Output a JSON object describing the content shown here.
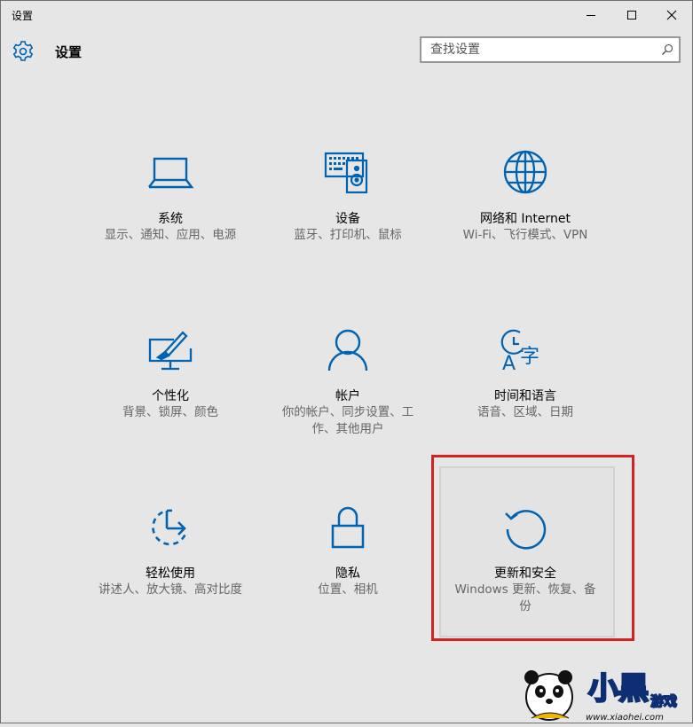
{
  "window": {
    "title": "设置",
    "controls": {
      "minimize": "minimize-icon",
      "maximize": "maximize-icon",
      "close": "close-icon"
    }
  },
  "header": {
    "icon": "gear-icon",
    "title": "设置"
  },
  "search": {
    "placeholder": "查找设置",
    "icon": "search-icon"
  },
  "accent_color": "#0063b1",
  "highlight_color": "#d42121",
  "tiles": [
    {
      "name": "系统",
      "desc": "显示、通知、应用、电源",
      "icon": "laptop-icon"
    },
    {
      "name": "设备",
      "desc": "蓝牙、打印机、鼠标",
      "icon": "keyboard-speaker-icon"
    },
    {
      "name": "网络和 Internet",
      "desc": "Wi-Fi、飞行模式、VPN",
      "icon": "globe-icon"
    },
    {
      "name": "个性化",
      "desc": "背景、锁屏、颜色",
      "icon": "paint-monitor-icon"
    },
    {
      "name": "帐户",
      "desc": "你的帐户、同步设置、工作、其他用户",
      "icon": "person-icon"
    },
    {
      "name": "时间和语言",
      "desc": "语音、区域、日期",
      "icon": "clock-language-icon"
    },
    {
      "name": "轻松使用",
      "desc": "讲述人、放大镜、高对比度",
      "icon": "ease-of-access-icon"
    },
    {
      "name": "隐私",
      "desc": "位置、相机",
      "icon": "lock-icon"
    },
    {
      "name": "更新和安全",
      "desc": "Windows 更新、恢复、备份",
      "icon": "refresh-icon"
    }
  ],
  "watermark": {
    "brand": "小黑游戏",
    "url": "www.xiaohei.com"
  }
}
